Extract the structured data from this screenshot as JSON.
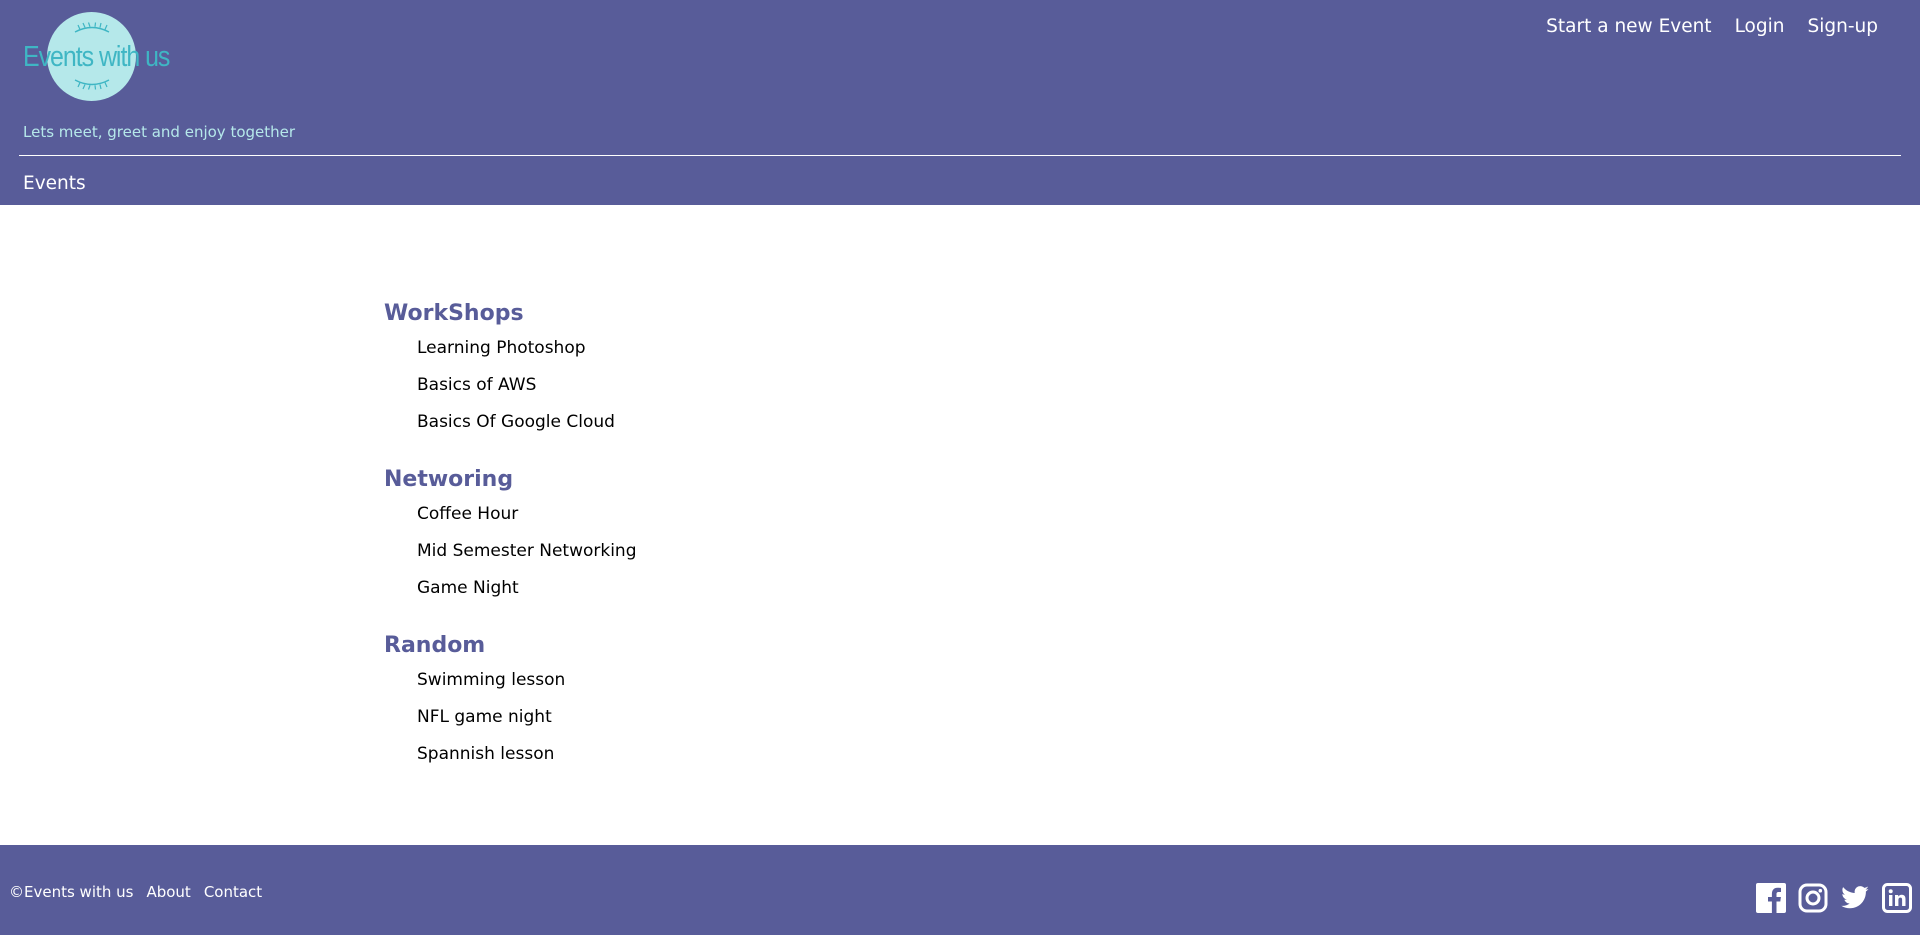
{
  "header": {
    "logo_text": "Events with us",
    "tagline": "Lets meet, greet and enjoy together",
    "nav": [
      {
        "label": "Start a new Event"
      },
      {
        "label": "Login"
      },
      {
        "label": "Sign-up"
      }
    ],
    "section_link": "Events"
  },
  "categories": [
    {
      "title": "WorkShops",
      "items": [
        "Learning Photoshop",
        "Basics of AWS",
        "Basics Of Google Cloud"
      ]
    },
    {
      "title": "Networing",
      "items": [
        "Coffee Hour",
        "Mid Semester Networking",
        "Game Night"
      ]
    },
    {
      "title": "Random",
      "items": [
        "Swimming lesson",
        "NFL game night",
        "Spannish lesson"
      ]
    }
  ],
  "footer": {
    "copyright": "©Events with us",
    "links": [
      {
        "label": "About"
      },
      {
        "label": "Contact"
      }
    ],
    "social_icons": [
      "facebook-icon",
      "instagram-icon",
      "twitter-icon",
      "linkedin-icon"
    ]
  },
  "colors": {
    "header_bg": "#585c99",
    "logo_circle": "#b5e8ea",
    "logo_text": "#3fb6c4",
    "category_title": "#585c99"
  }
}
